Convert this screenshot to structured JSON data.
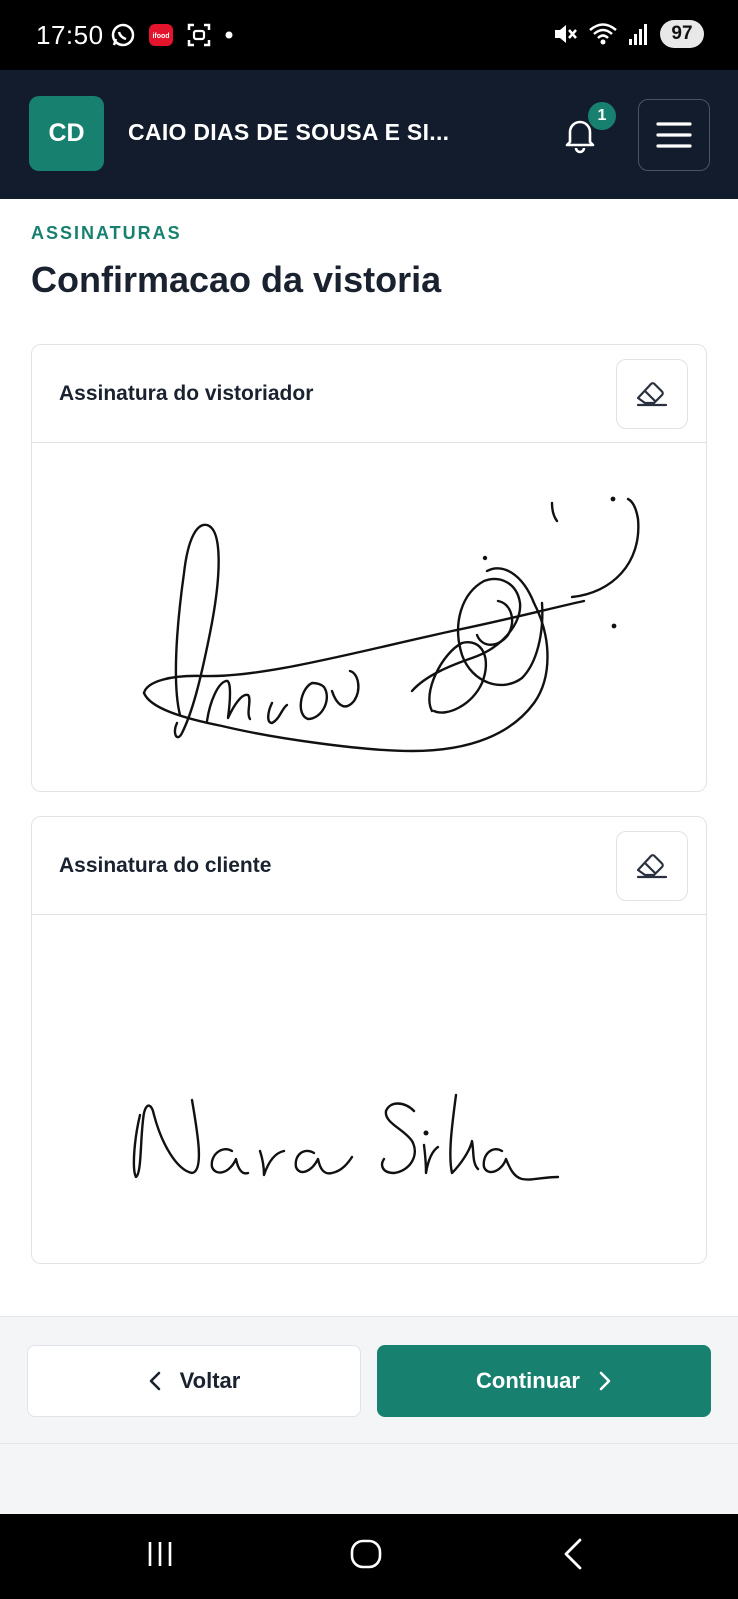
{
  "status_bar": {
    "time": "17:50",
    "battery": "97",
    "icons": [
      "whatsapp-icon",
      "ifood-icon",
      "screenshot-icon",
      "dot-icon",
      "mute-icon",
      "wifi-icon",
      "signal-icon",
      "battery-icon"
    ]
  },
  "header": {
    "avatar_initials": "CD",
    "company_name": "CAIO DIAS DE SOUSA E SI...",
    "notification_count": "1"
  },
  "page": {
    "kicker": "ASSINATURAS",
    "title": "Confirmacao da vistoria"
  },
  "signatures": [
    {
      "label": "Assinatura do vistoriador"
    },
    {
      "label": "Assinatura do cliente"
    }
  ],
  "footer": {
    "back_label": "Voltar",
    "continue_label": "Continuar"
  },
  "colors": {
    "accent": "#17806f",
    "header_bg": "#131c2c",
    "text": "#1a2230",
    "border": "#dfe3e8"
  }
}
